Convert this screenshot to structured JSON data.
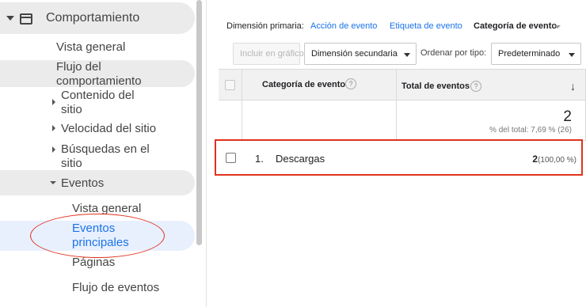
{
  "sidebar": {
    "section_title": "Comportamiento",
    "overview": "Vista general",
    "flow_line1": "Flujo del",
    "flow_line2": "comportamiento",
    "content_line1": "Contenido del",
    "content_line2": "sitio",
    "speed": "Velocidad del sitio",
    "search_line1": "Búsquedas en el",
    "search_line2": "sitio",
    "events": "Eventos",
    "events_overview": "Vista general",
    "events_top_line1": "Eventos",
    "events_top_line2": "principales",
    "pages": "Páginas",
    "event_flow": "Flujo de eventos"
  },
  "topbar": {
    "primary_dimension_label": "Dimensión primaria:",
    "opt_action": "Acción de evento",
    "opt_label": "Etiqueta de evento",
    "opt_category": "Categoría de evento"
  },
  "toolbar": {
    "plot_rows": "Incluir en gráfico",
    "secondary_dimension": "Dimensión secundaria",
    "sort_type_label": "Ordenar por tipo:",
    "sort_type_value": "Predeterminado"
  },
  "table": {
    "col_category": "Categoría de evento",
    "col_total_events": "Total de eventos",
    "help_glyph": "?",
    "sort_arrow": "↓",
    "total_value": "2",
    "total_sub": "% del total: 7,69 % (26)",
    "rows": [
      {
        "index": "1.",
        "name": "Descargas",
        "value": "2",
        "percent": "(100,00 %)"
      }
    ]
  },
  "colors": {
    "accent_blue": "#1a73e8",
    "annotation_red": "#e0321e",
    "sidebar_highlight": "#ebebeb",
    "active_bg": "#e8f0fe"
  }
}
